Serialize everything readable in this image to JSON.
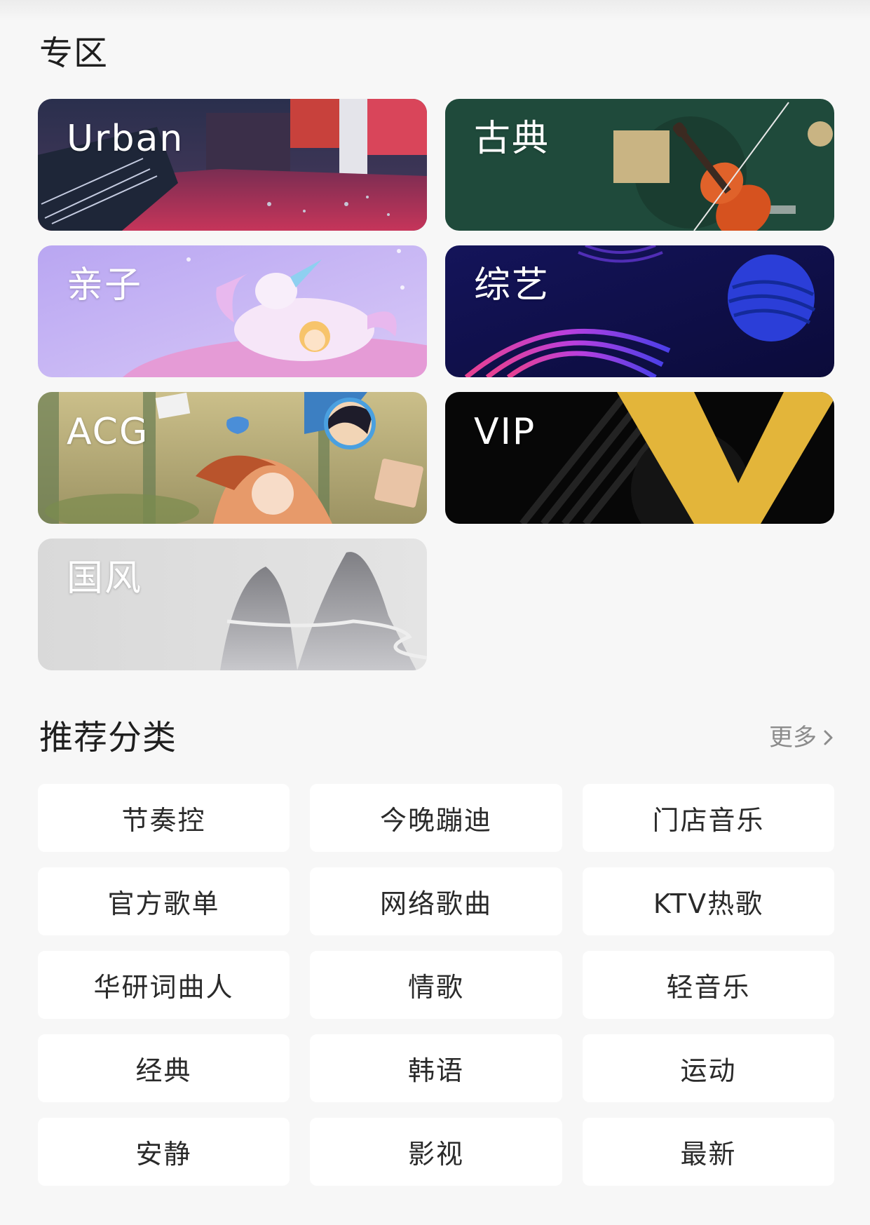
{
  "zone": {
    "title": "专区",
    "cards": [
      {
        "label": "Urban",
        "art": "urban-stadium-art"
      },
      {
        "label": "古典",
        "art": "violin-art"
      },
      {
        "label": "亲子",
        "art": "unicorn-art"
      },
      {
        "label": "综艺",
        "art": "neon-sphere-art"
      },
      {
        "label": "ACG",
        "art": "anime-characters-art"
      },
      {
        "label": "VIP",
        "art": "gold-v-art"
      },
      {
        "label": "国风",
        "art": "ink-mountain-art"
      }
    ]
  },
  "recommend": {
    "title": "推荐分类",
    "more_label": "更多",
    "categories": [
      "节奏控",
      "今晚蹦迪",
      "门店音乐",
      "官方歌单",
      "网络歌曲",
      "KTV热歌",
      "华研词曲人",
      "情歌",
      "轻音乐",
      "经典",
      "韩语",
      "运动",
      "安静",
      "影视",
      "最新"
    ]
  },
  "colors": {
    "background": "#f7f7f7",
    "card_bg": "#ffffff",
    "secondary_text": "#8c8c8c",
    "vip_gold": "#e3b53a"
  },
  "icons": {
    "more_arrow": "chevron-right-icon"
  }
}
